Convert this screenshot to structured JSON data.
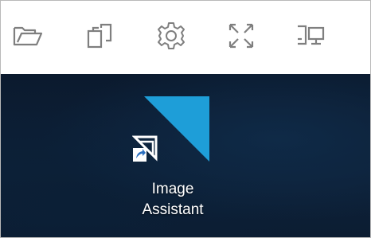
{
  "toolbar": {
    "buttons": [
      {
        "name": "open-folder",
        "icon": "folder-open-icon"
      },
      {
        "name": "switch-window",
        "icon": "windows-copy-icon"
      },
      {
        "name": "settings",
        "icon": "gear-icon"
      },
      {
        "name": "fullscreen",
        "icon": "expand-icon"
      },
      {
        "name": "display",
        "icon": "monitor-icon"
      }
    ],
    "icon_color": "#7f7f7f"
  },
  "desktop": {
    "background_color": "#0c1d32",
    "icons": [
      {
        "label": "Image\nAssistant",
        "icon": "image-assistant-icon",
        "is_shortcut": true,
        "accent_color": "#1e9ed8"
      }
    ]
  }
}
